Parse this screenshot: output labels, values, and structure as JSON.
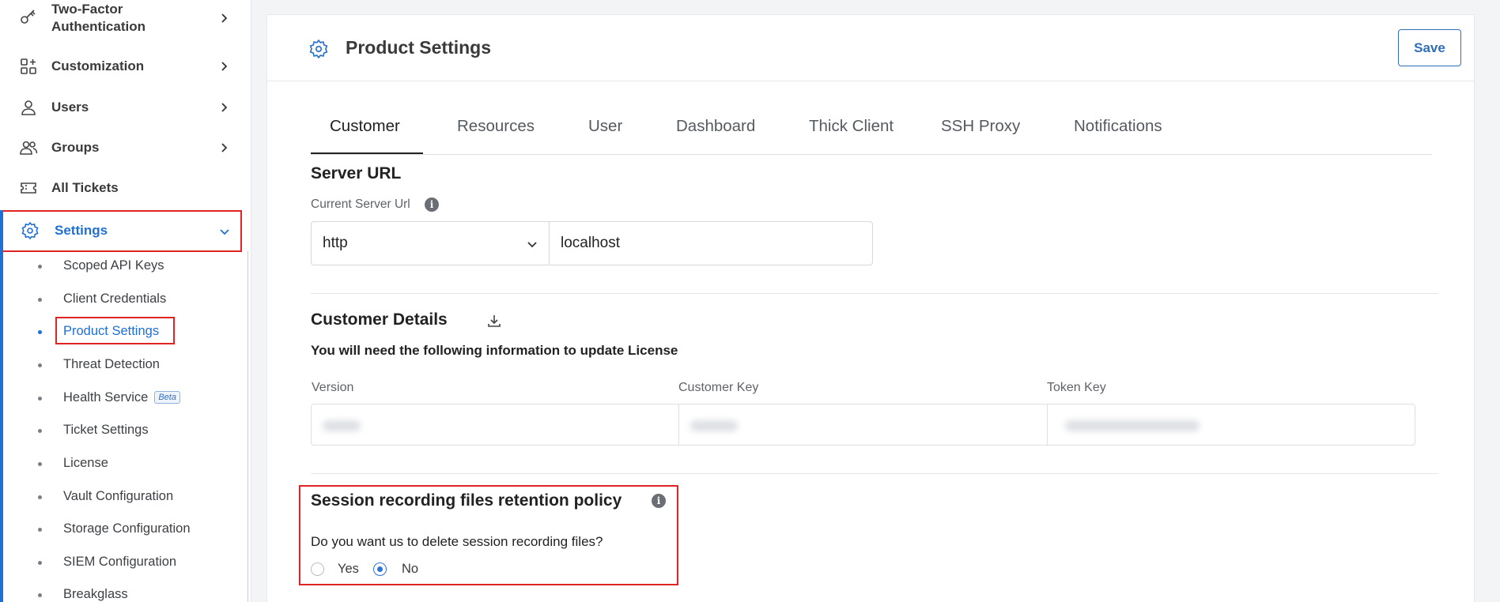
{
  "sidebar": {
    "nav": [
      {
        "label": "Two-Factor Authentication",
        "line1": "Two-Factor",
        "line2": "Authentication",
        "icon": "key-icon"
      },
      {
        "label": "Customization",
        "icon": "grid-plus-icon"
      },
      {
        "label": "Users",
        "icon": "user-icon"
      },
      {
        "label": "Groups",
        "icon": "users-icon"
      },
      {
        "label": "All Tickets",
        "icon": "ticket-icon"
      },
      {
        "label": "Settings",
        "icon": "gear-icon"
      }
    ],
    "sub_items": [
      {
        "label": "Scoped API Keys"
      },
      {
        "label": "Client Credentials"
      },
      {
        "label": "Product Settings",
        "active": true
      },
      {
        "label": "Threat Detection"
      },
      {
        "label": "Health Service",
        "badge": "Beta"
      },
      {
        "label": "Ticket Settings"
      },
      {
        "label": "License"
      },
      {
        "label": "Vault Configuration"
      },
      {
        "label": "Storage Configuration"
      },
      {
        "label": "SIEM Configuration"
      },
      {
        "label": "Breakglass"
      }
    ]
  },
  "header": {
    "title": "Product Settings",
    "save_label": "Save"
  },
  "tabs": [
    {
      "label": "Customer",
      "active": true
    },
    {
      "label": "Resources"
    },
    {
      "label": "User"
    },
    {
      "label": "Dashboard"
    },
    {
      "label": "Thick Client"
    },
    {
      "label": "SSH Proxy"
    },
    {
      "label": "Notifications"
    }
  ],
  "server_url": {
    "title": "Server URL",
    "label": "Current Server Url",
    "protocol": "http",
    "host": "localhost"
  },
  "customer_details": {
    "title": "Customer Details",
    "note": "You will need the following information to update License",
    "columns": [
      "Version",
      "Customer Key",
      "Token Key"
    ]
  },
  "retention": {
    "title": "Session recording files retention policy",
    "question": "Do you want us to delete session recording files?",
    "options": [
      {
        "label": "Yes",
        "checked": false
      },
      {
        "label": "No",
        "checked": true
      }
    ]
  },
  "colors": {
    "accent": "#1f6fd6",
    "highlight_box": "#e02424"
  }
}
